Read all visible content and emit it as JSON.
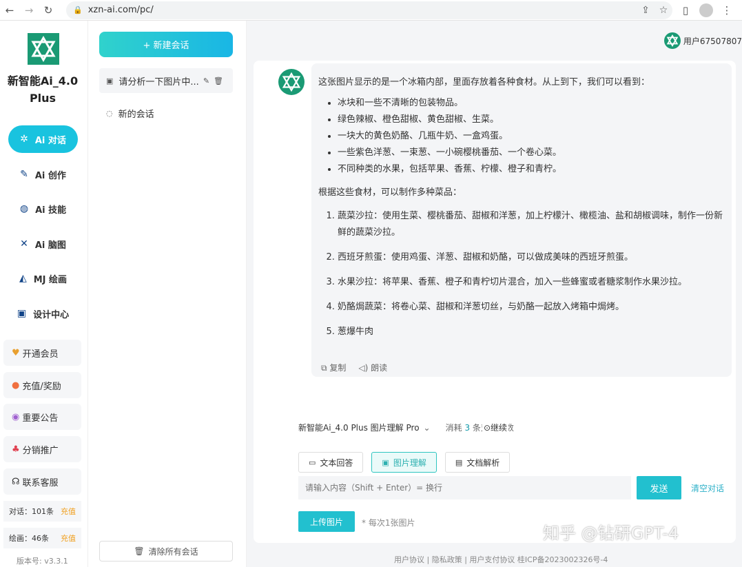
{
  "browser": {
    "url": "xzn-ai.com/pc/"
  },
  "brand": {
    "name": "新智能Ai_4.0 Plus"
  },
  "nav": {
    "items": [
      {
        "label": "Ai 对话",
        "icon": "gear-icon"
      },
      {
        "label": "Ai 创作",
        "icon": "pen-icon"
      },
      {
        "label": "Ai 技能",
        "icon": "skill-icon"
      },
      {
        "label": "Ai 脑图",
        "icon": "mindmap-icon"
      },
      {
        "label": "MJ 绘画",
        "icon": "paint-icon"
      },
      {
        "label": "设计中心",
        "icon": "image-icon"
      }
    ],
    "buttons": [
      {
        "label": "开通会员",
        "icon": "vip-icon"
      },
      {
        "label": "充值/奖励",
        "icon": "coin-icon"
      },
      {
        "label": "重要公告",
        "icon": "eye-icon"
      },
      {
        "label": "分销推广",
        "icon": "network-icon"
      },
      {
        "label": "联系客服",
        "icon": "headset-icon"
      }
    ],
    "stats": [
      {
        "label": "对话：101条",
        "action": "充值"
      },
      {
        "label": "绘画：46条",
        "action": "充值"
      }
    ],
    "version": "版本号: v3.3.1"
  },
  "sessions": {
    "new_chat": "+ 新建会话",
    "items": [
      {
        "title": "请分析一下图片中..."
      },
      {
        "title": "新的会话"
      }
    ],
    "clear_all": "清除所有会话"
  },
  "header": {
    "user": "用户67507807"
  },
  "message": {
    "intro": "这张图片显示的是一个冰箱内部，里面存放着各种食材。从上到下，我们可以看到：",
    "bullets": [
      "冰块和一些不清晰的包装物品。",
      "绿色辣椒、橙色甜椒、黄色甜椒、生菜。",
      "一块大的黄色奶酪、几瓶牛奶、一盒鸡蛋。",
      "一些紫色洋葱、一束葱、一小碗樱桃番茄、一个卷心菜。",
      "不同种类的水果，包括苹果、香蕉、柠檬、橙子和青柠。"
    ],
    "mid": "根据这些食材，可以制作多种菜品：",
    "dishes": [
      "蔬菜沙拉：使用生菜、樱桃番茄、甜椒和洋葱，加上柠檬汁、橄榄油、盐和胡椒调味，制作一份新鲜的蔬菜沙拉。",
      "西班牙煎蛋：使用鸡蛋、洋葱、甜椒和奶酪，可以做成美味的西班牙煎蛋。",
      "水果沙拉：将苹果、香蕉、橙子和青柠切片混合，加入一些蜂蜜或者糖浆制作水果沙拉。",
      "奶酪焗蔬菜：将卷心菜、甜椒和洋葱切丝，与奶酪一起放入烤箱中焗烤。",
      "葱爆牛肉"
    ],
    "copy": "复制",
    "read": "朗读"
  },
  "composer": {
    "model": "新智能Ai_4.0 Plus 图片理解 Pro",
    "cost_prefix": "消耗",
    "cost_num": "3",
    "cost_suffix": "条对话次数",
    "continue": "继续",
    "tabs": [
      "文本回答",
      "图片理解",
      "文档解析"
    ],
    "placeholder": "请输入内容（Shift + Enter）= 换行",
    "send": "发送",
    "clear": "清空对话",
    "upload": "上传图片",
    "upload_tip": "* 每次1张图片"
  },
  "footer": {
    "text": "用户协议 | 隐私政策 | 用户支付协议    桂ICP备2023002326号-4"
  },
  "watermark": "知乎 @钻研GPT-4",
  "colors": {
    "accent": "#19c3df",
    "brand": "#1a9a74"
  }
}
